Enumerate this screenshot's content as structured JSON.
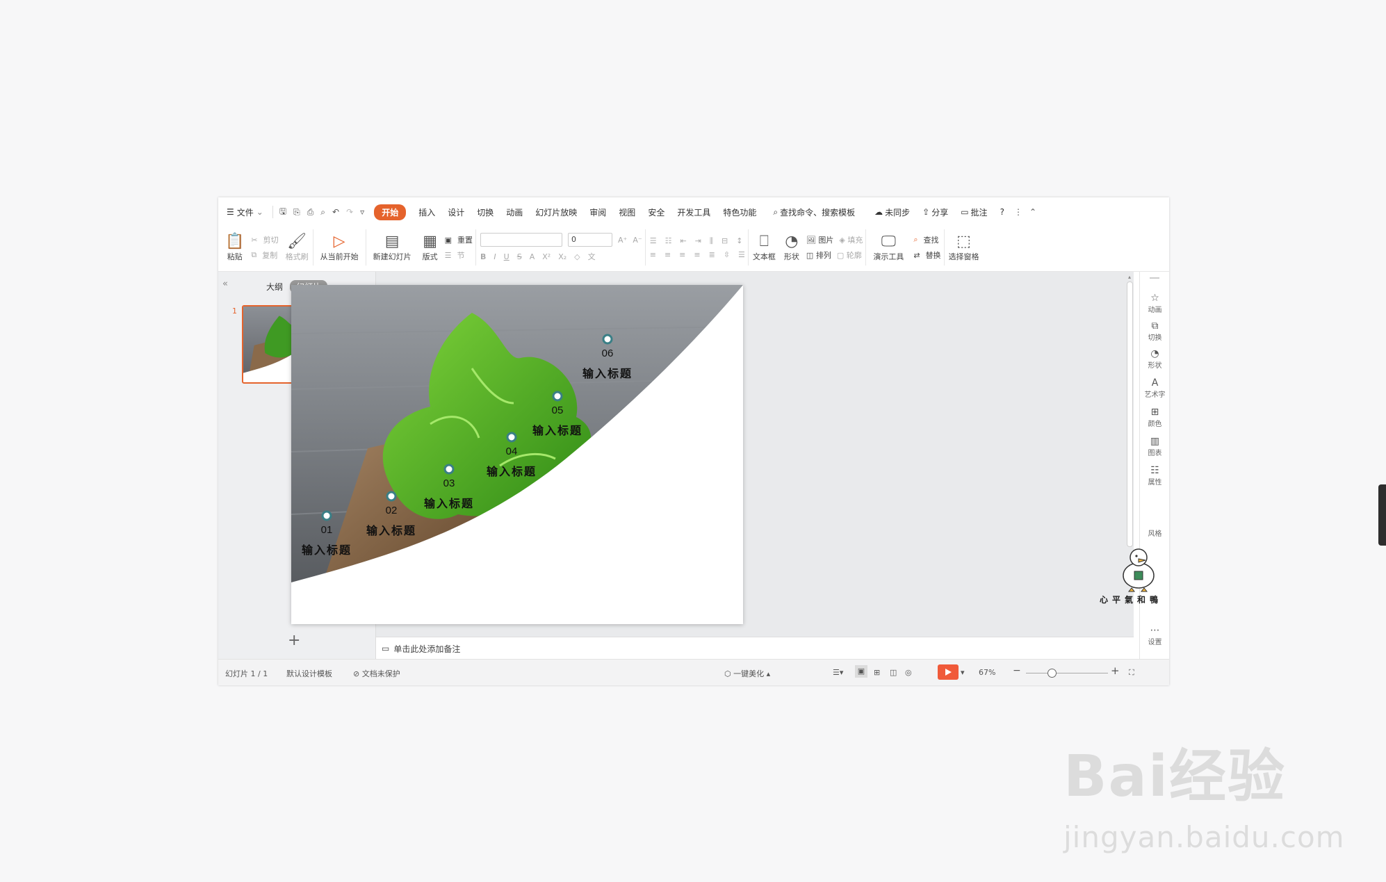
{
  "menubar": {
    "file": "文件",
    "tabs": [
      "开始",
      "插入",
      "设计",
      "切换",
      "动画",
      "幻灯片放映",
      "审阅",
      "视图",
      "安全",
      "开发工具",
      "特色功能"
    ],
    "search": "查找命令、搜索模板",
    "unsynced": "未同步",
    "share": "分享",
    "comment": "批注",
    "help": "?"
  },
  "ribbon": {
    "paste": "粘贴",
    "cut": "剪切",
    "copy": "复制",
    "format_painter": "格式刷",
    "play_from_current": "从当前开始",
    "new_slide": "新建幻灯片",
    "layout": "版式",
    "reset": "重置",
    "section": "节",
    "font_size": "0",
    "textbox": "文本框",
    "shape": "形状",
    "picture": "图片",
    "fill": "填充",
    "arrange": "排列",
    "outline": "轮廓",
    "present_tools": "演示工具",
    "find": "查找",
    "replace": "替换",
    "select_pane": "选择窗格"
  },
  "left_pane": {
    "outline_tab": "大纲",
    "slides_tab": "幻灯片",
    "slide_number": "1",
    "add": "+"
  },
  "slide": {
    "items": [
      {
        "num": "01",
        "title": "输入标题"
      },
      {
        "num": "02",
        "title": "输入标题"
      },
      {
        "num": "03",
        "title": "输入标题"
      },
      {
        "num": "04",
        "title": "输入标题"
      },
      {
        "num": "05",
        "title": "输入标题"
      },
      {
        "num": "06",
        "title": "输入标题"
      }
    ],
    "accent_color": "#3a7f86"
  },
  "notes": {
    "placeholder": "单击此处添加备注"
  },
  "right_bar": {
    "items": [
      "动画",
      "切换",
      "形状",
      "艺术字",
      "颜色",
      "图表",
      "属性",
      "风格",
      "设置"
    ],
    "mascot_caption": "心平氣和鴨"
  },
  "status": {
    "slide_count": "幻灯片 1 / 1",
    "template": "默认设计模板",
    "protection": "文档未保护",
    "beautify": "一键美化",
    "zoom": "67%"
  },
  "watermark": {
    "brand": "Bai经验",
    "url": "jingyan.baidu.com"
  }
}
